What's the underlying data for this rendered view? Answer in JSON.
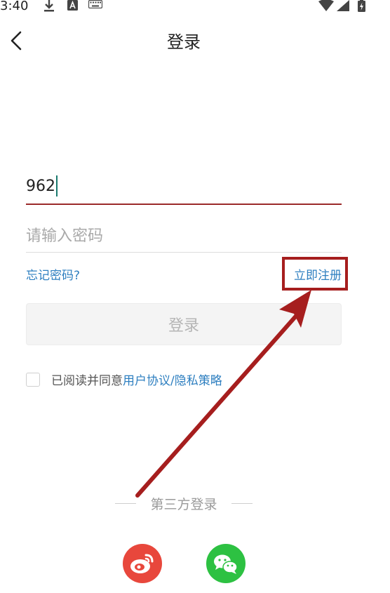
{
  "status_bar": {
    "time": "3:40",
    "icons": [
      "download-icon",
      "text-a-icon",
      "keyboard-icon",
      "wifi-icon",
      "signal-icon",
      "battery-icon"
    ]
  },
  "header": {
    "title": "登录",
    "back_icon": "chevron-left-icon"
  },
  "form": {
    "phone_value": "962",
    "password_placeholder": "请输入密码",
    "forgot_label": "忘记密码?",
    "register_label": "立即注册",
    "login_label": "登录"
  },
  "agreement": {
    "prefix": "已阅读并同意",
    "link": "用户协议/隐私策略",
    "checked": false
  },
  "third_party": {
    "label": "第三方登录",
    "providers": [
      "weibo-icon",
      "wechat-icon"
    ]
  },
  "colors": {
    "accent_link": "#2e7fc0",
    "input_focus_underline": "#9b2a2a",
    "annotation_red": "#a61e1e",
    "weibo": "#e8473c",
    "wechat": "#2dc142"
  }
}
